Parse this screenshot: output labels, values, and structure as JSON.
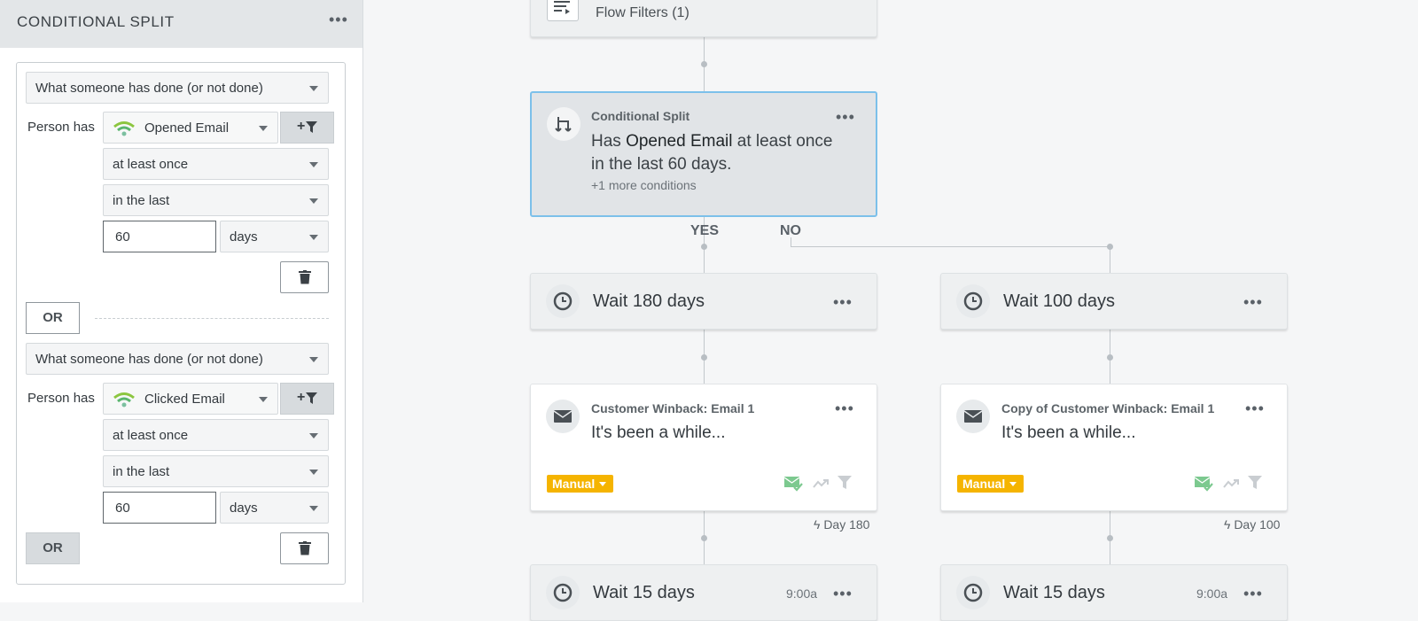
{
  "sidebar": {
    "title": "CONDITIONAL SPLIT",
    "menu_icon": "more-dots-icon",
    "conditions": [
      {
        "type_select": "What someone has done (or not done)",
        "person_has_label": "Person has",
        "metric": "Opened Email",
        "metric_icon": "integration-wifi-icon",
        "frequency": "at least once",
        "timeframe": "in the last",
        "amount": "60",
        "unit": "days"
      },
      {
        "type_select": "What someone has done (or not done)",
        "person_has_label": "Person has",
        "metric": "Clicked Email",
        "metric_icon": "integration-wifi-icon",
        "frequency": "at least once",
        "timeframe": "in the last",
        "amount": "60",
        "unit": "days"
      }
    ],
    "or_label": "OR",
    "filter_button_label": "+",
    "or_button_label": "OR"
  },
  "canvas": {
    "flow_filters": "Flow Filters (1)",
    "split": {
      "title": "Conditional Split",
      "text_pre": "Has ",
      "text_metric": "Opened Email",
      "text_post": " at least once",
      "text_line2": "in the last 60 days.",
      "more": "+1 more conditions"
    },
    "yes_label": "YES",
    "no_label": "NO",
    "branches": [
      {
        "wait": "Wait 180 days",
        "email_title": "Customer Winback: Email 1",
        "email_subject": "It's been a while...",
        "status": "Manual",
        "day": "Day 180",
        "wait2": "Wait 15 days",
        "wait2_time": "9:00a"
      },
      {
        "wait": "Wait 100 days",
        "email_title": "Copy of Customer Winback: Email 1",
        "email_subject": "It's been a while...",
        "status": "Manual",
        "day": "Day 100",
        "wait2": "Wait 15 days",
        "wait2_time": "9:00a"
      }
    ],
    "colors": {
      "selected_border": "#7cc0ea",
      "manual_badge": "#f5b400",
      "smart_sending": "#7cc98f"
    }
  }
}
